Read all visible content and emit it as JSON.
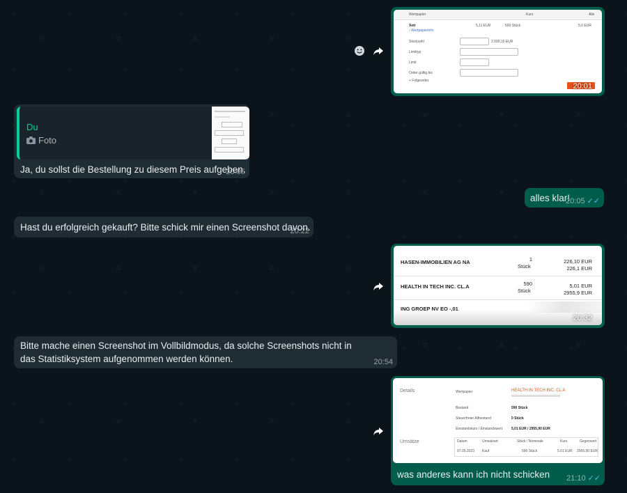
{
  "chat": {
    "msg1": {
      "time": "20:01"
    },
    "msg2": {
      "quote_author": "Du",
      "quote_label": "Foto",
      "text": "Ja, du sollst die Bestellung zu diesem Preis aufgeben.",
      "time": "20:05"
    },
    "msg3": {
      "text": "alles klar!",
      "time": "20:05"
    },
    "msg4": {
      "text": "Hast du erfolgreich gekauft? Bitte schick mir einen Screenshot davon.",
      "time": "20:22"
    },
    "msg5": {
      "time": "20:32",
      "rows": [
        {
          "name": "HASEN-IMMOBILIEN AG NA",
          "qty": "1",
          "unit": "Stück",
          "price": "226,10 EUR",
          "total": "226,1 EUR"
        },
        {
          "name": "HEALTH IN TECH INC. CL.A",
          "qty": "590",
          "unit": "Stück",
          "price": "5,01 EUR",
          "total": "2955,9 EUR"
        },
        {
          "name": "ING GROEP NV EO -,01",
          "qty": "",
          "unit": "",
          "price": "",
          "total": ""
        }
      ]
    },
    "msg6": {
      "text": "Bitte mache einen Screenshot im Vollbildmodus, da solche Screenshots nicht in das Statistiksystem aufgenommen werden können.",
      "time": "20:54"
    },
    "msg7": {
      "text": "was anderes kann ich nicht schicken",
      "time": "21:10",
      "details_label": "Details",
      "umsaetze_label": "Umsätze",
      "wp_label": "Wertpapier",
      "wp_value": "HEALTH IN TECH INC. CL.A",
      "bestand_label": "Bestand",
      "bestand_value": "590 Stück",
      "steuer_label": "Steuerfreier Altbestand",
      "steuer_value": "0 Stück",
      "einstand_label": "Einstandskurs / Einstandswert",
      "einstand_value": "5,01 EUR / 2955,90 EUR",
      "table_headers": [
        "Datum",
        "Umsatzart",
        "Stück / Nominale",
        "Kurs",
        "Gegenwert"
      ],
      "table_row": [
        "07.05.2023",
        "Kauf",
        "590 Stück",
        "5,01 EUR",
        "2955,90 EUR"
      ]
    }
  },
  "colors": {
    "incoming": "#202c33",
    "outgoing": "#005c4b",
    "background": "#0b141a",
    "accent": "#00a884",
    "read_ticks": "#53bdeb"
  }
}
